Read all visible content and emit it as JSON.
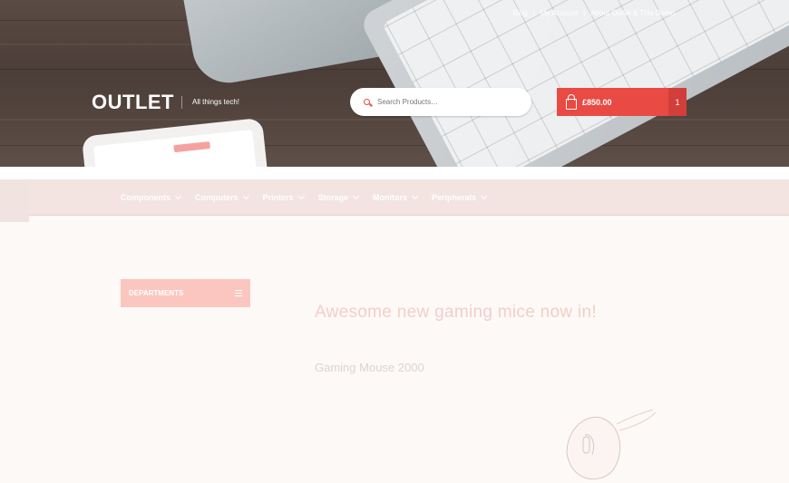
{
  "header": {
    "top_links": [
      "Blog",
      "My Account",
      "About Outlet & This Demo"
    ],
    "separator": "|",
    "logo": "OUTLET",
    "tagline": "All things tech!",
    "search": {
      "placeholder": "Search Products…"
    },
    "cart": {
      "total": "£850.00",
      "count": "1"
    }
  },
  "nav": {
    "items": [
      {
        "label": "Components"
      },
      {
        "label": "Computers"
      },
      {
        "label": "Printers"
      },
      {
        "label": "Storage"
      },
      {
        "label": "Monitors"
      },
      {
        "label": "Peripherals"
      }
    ]
  },
  "sidebar": {
    "departments_label": "DEPARTMENTS"
  },
  "promo": {
    "title": "Awesome new gaming mice now in!",
    "subtitle": "Gaming Mouse 2000"
  },
  "colors": {
    "accent": "#e94a44",
    "nav_bg": "#f3e4e1",
    "departments_bg": "#fbc6bf"
  }
}
